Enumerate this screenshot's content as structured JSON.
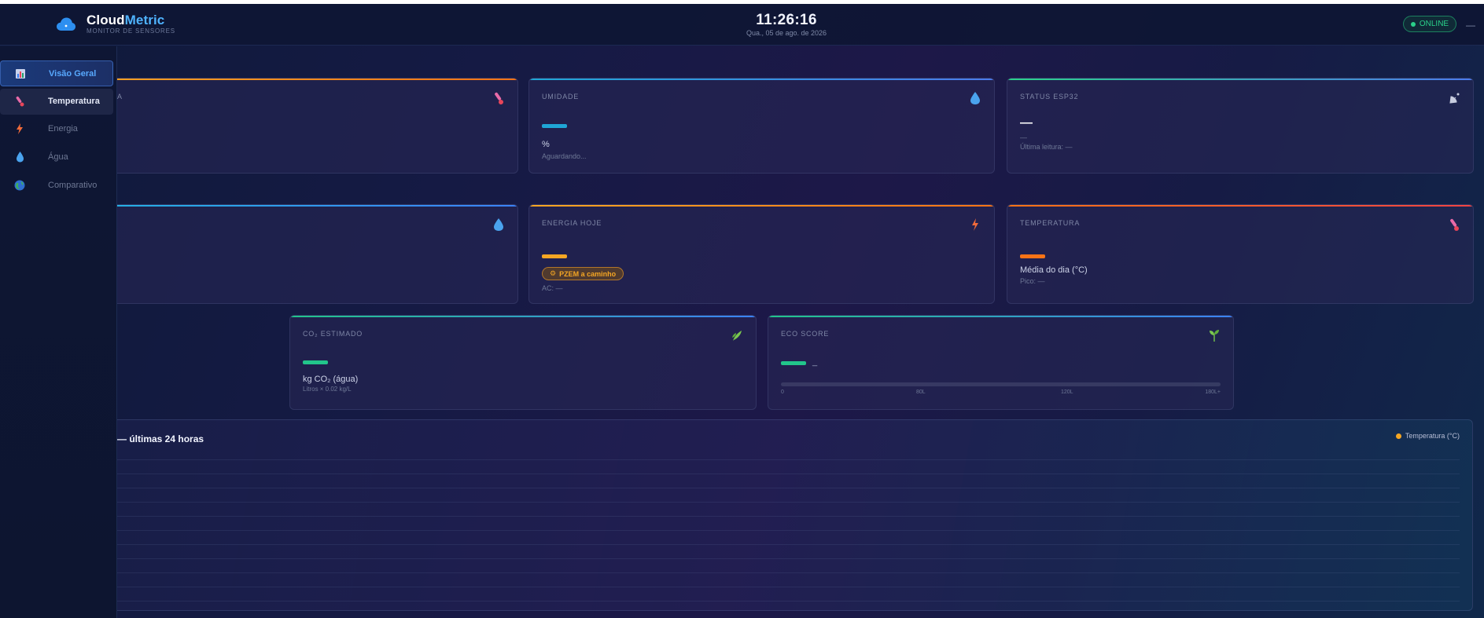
{
  "header": {
    "brand_part1": "Cloud",
    "brand_part2": "Metric",
    "brand_subtitle": "MONITOR DE SENSORES",
    "clock": "11:26:16",
    "date": "Qua., 05 de ago. de 2026",
    "status": "ONLINE",
    "status_color": "#2ad18a",
    "menu_dash": "—"
  },
  "sidebar": {
    "items": [
      {
        "label": "Visão Geral",
        "icon": "bar-chart-icon",
        "state": "active"
      },
      {
        "label": "Temperatura",
        "icon": "thermometer-icon",
        "state": "hover"
      },
      {
        "label": "Energia",
        "icon": "lightning-icon",
        "state": "normal"
      },
      {
        "label": "Água",
        "icon": "water-drop-icon",
        "state": "normal"
      },
      {
        "label": "Comparativo",
        "icon": "globe-icon",
        "state": "normal"
      }
    ]
  },
  "cards": {
    "temperature_partial": {
      "label_fragment": "A",
      "icon": "thermometer-icon",
      "accent": "#f5a623"
    },
    "humidity": {
      "label": "UMIDADE",
      "unit": "%",
      "note": "Aguardando...",
      "icon": "water-drop-icon",
      "accent": "#1fa6d6"
    },
    "esp32": {
      "label": "STATUS ESP32",
      "value": "—",
      "sub": "—",
      "last_reading": "Última leitura: —",
      "icon": "satellite-icon",
      "accent": "#2ad18a"
    },
    "water_partial": {
      "icon": "water-drop-icon",
      "accent": "#3b82f6"
    },
    "energy_today": {
      "label": "ENERGIA HOJE",
      "pill": "PZEM a caminho",
      "ac": "AC: —",
      "icon": "lightning-icon",
      "accent": "#f5a623"
    },
    "temperature": {
      "label": "TEMPERATURA",
      "unit": "Média do dia (°C)",
      "peak": "Pico: —",
      "icon": "thermometer-icon",
      "accent": "#f97316"
    },
    "co2": {
      "label": "CO₂ ESTIMADO",
      "unit": "kg CO₂ (água)",
      "formula": "Litros × 0.02 kg/L",
      "icon": "herb-icon",
      "accent": "#22c58b"
    },
    "eco_score": {
      "label": "ECO SCORE",
      "value": "_",
      "scale": [
        "0",
        "80L",
        "120L",
        "180L+"
      ],
      "icon": "seedling-icon",
      "accent": "#22c58b"
    }
  },
  "chart": {
    "title_fragment": "— últimas 24 horas",
    "legend": "Temperatura (°C)"
  },
  "chart_data": {
    "type": "line",
    "series": [
      {
        "name": "Temperatura (°C)",
        "values": []
      }
    ],
    "legend_placement": "top-right",
    "grid": true
  }
}
